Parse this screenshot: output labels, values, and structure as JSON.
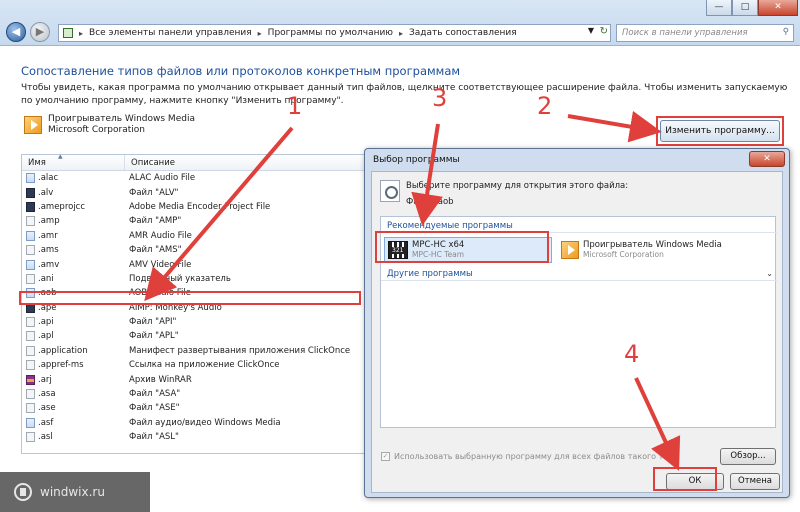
{
  "window": {
    "minimize": "—",
    "maximize": "□",
    "close": "✕"
  },
  "address_bar": {
    "crumbs": [
      "Все элементы панели управления",
      "Программы по умолчанию",
      "Задать сопоставления"
    ],
    "search_placeholder": "Поиск в панели управления"
  },
  "main": {
    "heading": "Сопоставление типов файлов или протоколов конкретным программам",
    "description": "Чтобы увидеть, какая программа по умолчанию открывает данный тип файлов, щелкните соответствующее расширение файла. Чтобы изменить запускаемую по умолчанию программу, нажмите кнопку \"Изменить программу\".",
    "current_program": {
      "name": "Проигрыватель Windows Media",
      "company": "Microsoft Corporation"
    },
    "change_button": "Изменить программу..."
  },
  "list": {
    "col_name": "Имя",
    "col_desc": "Описание",
    "rows": [
      {
        "name": ".alac",
        "desc": "ALAC Audio File",
        "icon": "audio"
      },
      {
        "name": ".alv",
        "desc": "Файл \"ALV\"",
        "icon": "dark"
      },
      {
        "name": ".ameprojcc",
        "desc": "Adobe Media Encoder Project File",
        "icon": "dark"
      },
      {
        "name": ".amp",
        "desc": "Файл \"AMP\"",
        "icon": "file"
      },
      {
        "name": ".amr",
        "desc": "AMR Audio File",
        "icon": "audio"
      },
      {
        "name": ".ams",
        "desc": "Файл \"AMS\"",
        "icon": "file"
      },
      {
        "name": ".amv",
        "desc": "AMV Video File",
        "icon": "audio"
      },
      {
        "name": ".ani",
        "desc": "Подвижный указатель",
        "icon": "file"
      },
      {
        "name": ".aob",
        "desc": "AOB Audio File",
        "icon": "audio"
      },
      {
        "name": ".ape",
        "desc": "AIMP: Monkey's Audio",
        "icon": "dark"
      },
      {
        "name": ".api",
        "desc": "Файл \"API\"",
        "icon": "file"
      },
      {
        "name": ".apl",
        "desc": "Файл \"APL\"",
        "icon": "file"
      },
      {
        "name": ".application",
        "desc": "Манифест развертывания приложения ClickOnce",
        "icon": "file"
      },
      {
        "name": ".appref-ms",
        "desc": "Ссылка на приложение ClickOnce",
        "icon": "file"
      },
      {
        "name": ".arj",
        "desc": "Архив WinRAR",
        "icon": "rar"
      },
      {
        "name": ".asa",
        "desc": "Файл \"ASA\"",
        "icon": "file"
      },
      {
        "name": ".ase",
        "desc": "Файл \"ASE\"",
        "icon": "file"
      },
      {
        "name": ".asf",
        "desc": "Файл аудио/видео Windows Media",
        "icon": "audio"
      },
      {
        "name": ".asl",
        "desc": "Файл \"ASL\"",
        "icon": "file"
      }
    ]
  },
  "dialog": {
    "title": "Выбор программы",
    "close": "✕",
    "prompt": "Выберите программу для открытия этого файла:",
    "file_label": "Файл: .aob",
    "recommended_label": "Рекомендуемые программы",
    "other_label": "Другие программы",
    "programs": [
      {
        "name": "MPC-HC x64",
        "company": "MPC-HC Team"
      },
      {
        "name": "Проигрыватель Windows Media",
        "company": "Microsoft Corporation"
      }
    ],
    "checkbox_label": "Использовать выбранную программу для всех файлов такого типа",
    "browse_button": "Обзор...",
    "ok_button": "ОК",
    "cancel_button": "Отмена"
  },
  "annotations": {
    "n1": "1",
    "n2": "2",
    "n3": "3",
    "n4": "4",
    "color": "#e0403b"
  },
  "watermark": {
    "text": "windwix.ru"
  }
}
